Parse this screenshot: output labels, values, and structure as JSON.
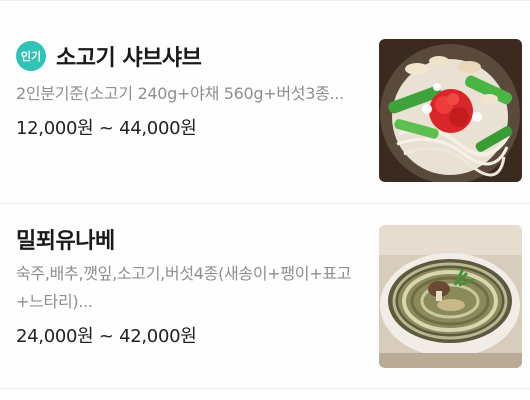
{
  "menu": {
    "items": [
      {
        "badge": "인기",
        "name": "소고기 샤브샤브",
        "description": "2인분기준(소고기 240g+야채 560g+버섯3종...",
        "price": "12,000원 ~ 44,000원",
        "image_icon": "shabu-shabu-photo"
      },
      {
        "badge": "",
        "name": "밀푀유나베",
        "description": "숙주,배추,깻잎,소고기,버섯4종(새송이+팽이+표고+느타리)...",
        "price": "24,000원 ~ 42,000원",
        "image_icon": "millefeuille-nabe-photo"
      }
    ]
  }
}
